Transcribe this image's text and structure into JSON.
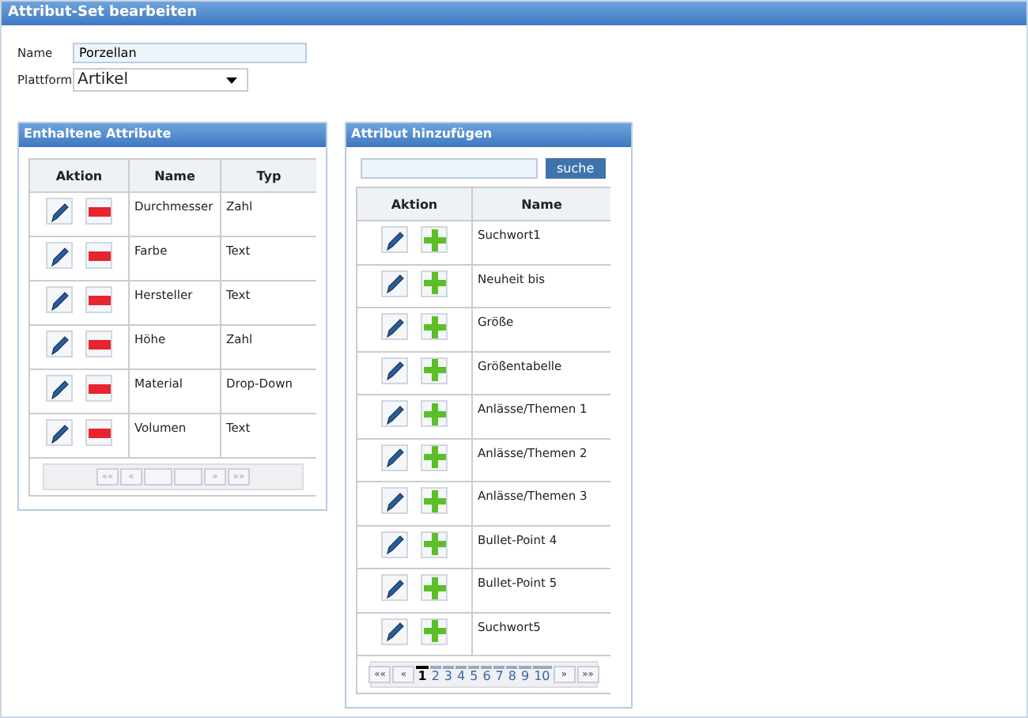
{
  "window": {
    "title": "Attribut-Set bearbeiten"
  },
  "form": {
    "name_label": "Name",
    "name_value": "Porzellan",
    "platform_label": "Plattform",
    "platform_value": "Artikel"
  },
  "included": {
    "title": "Enthaltene Attribute",
    "columns": [
      "Aktion",
      "Name",
      "Typ"
    ],
    "rows": [
      {
        "name": "Durchmesser",
        "type": "Zahl"
      },
      {
        "name": "Farbe",
        "type": "Text"
      },
      {
        "name": "Hersteller",
        "type": "Text"
      },
      {
        "name": "Höhe",
        "type": "Zahl"
      },
      {
        "name": "Material",
        "type": "Drop-Down"
      },
      {
        "name": "Volumen",
        "type": "Text"
      }
    ],
    "pager": {
      "first": "««",
      "prev": "«",
      "next": "»",
      "last": "»»",
      "disabled": true
    }
  },
  "add": {
    "title": "Attribut hinzufügen",
    "search_button": "suche",
    "columns": [
      "Aktion",
      "Name"
    ],
    "rows": [
      {
        "name": "Suchwort1"
      },
      {
        "name": "Neuheit bis"
      },
      {
        "name": "Größe"
      },
      {
        "name": "Größentabelle"
      },
      {
        "name": "Anlässe/Themen 1"
      },
      {
        "name": "Anlässe/Themen 2"
      },
      {
        "name": "Anlässe/Themen 3"
      },
      {
        "name": "Bullet-Point 4"
      },
      {
        "name": "Bullet-Point 5"
      },
      {
        "name": "Suchwort5"
      }
    ],
    "pager": {
      "first": "««",
      "prev": "«",
      "next": "»",
      "last": "»»",
      "disabled": false,
      "pages": [
        {
          "label": "1",
          "selected": true
        },
        {
          "label": "2",
          "selected": false
        },
        {
          "label": "3",
          "selected": false
        },
        {
          "label": "4",
          "selected": false
        },
        {
          "label": "5",
          "selected": false
        },
        {
          "label": "6",
          "selected": false
        },
        {
          "label": "7",
          "selected": false
        },
        {
          "label": "8",
          "selected": false
        },
        {
          "label": "9",
          "selected": false
        },
        {
          "label": "10",
          "selected": false
        }
      ]
    }
  }
}
